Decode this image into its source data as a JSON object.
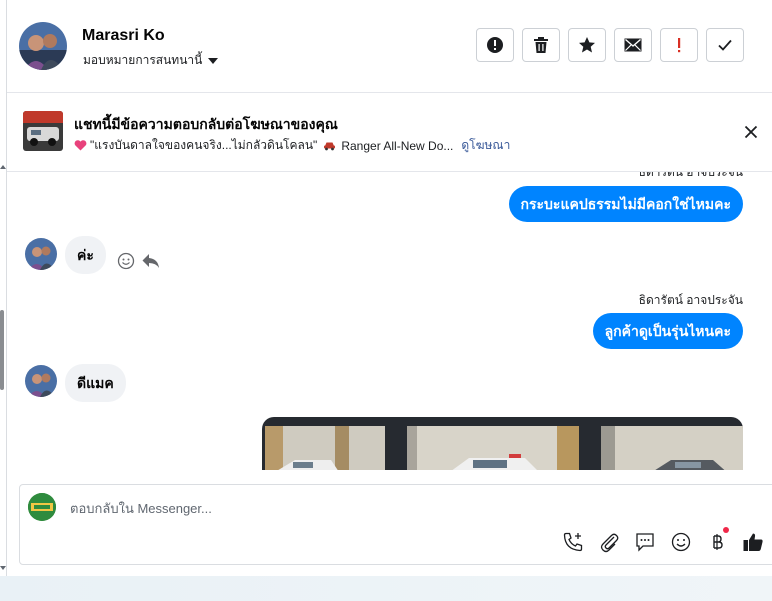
{
  "header": {
    "contact_name": "Marasri Ko",
    "assign_label": "มอบหมายการสนทนานี้",
    "actions": [
      {
        "name": "report-spam-button",
        "icon": "alert-circle-icon"
      },
      {
        "name": "delete-button",
        "icon": "trash-icon"
      },
      {
        "name": "star-button",
        "icon": "star-icon"
      },
      {
        "name": "mark-unread-button",
        "icon": "envelope-icon"
      },
      {
        "name": "flag-important-button",
        "icon": "exclamation-icon"
      },
      {
        "name": "mark-done-button",
        "icon": "checkmark-icon"
      }
    ]
  },
  "ad_banner": {
    "title": "แชทนี้มีข้อความตอบกลับต่อโฆษณาของคุณ",
    "ad_text": "\"แรงบันดาลใจของคนจริง...ไม่กลัวดินโคลน\"",
    "ad_text_2": "Ranger All-New Do...",
    "view_ad_link": "ดูโฆษณา"
  },
  "messages": {
    "sender_cut": "ธิดารัตน์ อาจประจัน",
    "out_1": "กระบะแคปธรรมไม่มีคอกใช่ไหมคะ",
    "in_1": "ค่ะ",
    "sender_2": "ธิดารัตน์ อาจประจัน",
    "out_2": "ลูกค้าดูเป็นรุ่นไหนคะ",
    "in_2": "ดีแมค"
  },
  "composer": {
    "placeholder": "ตอบกลับใน Messenger...",
    "tools": [
      "phone-add-icon",
      "paperclip-icon",
      "speech-bubble-icon",
      "smiley-icon",
      "baht-icon",
      "thumbs-up-icon"
    ]
  },
  "colors": {
    "accent": "#0084ff",
    "incoming_bubble": "#f0f2f5",
    "link": "#385898",
    "alert_red": "#d93025"
  }
}
